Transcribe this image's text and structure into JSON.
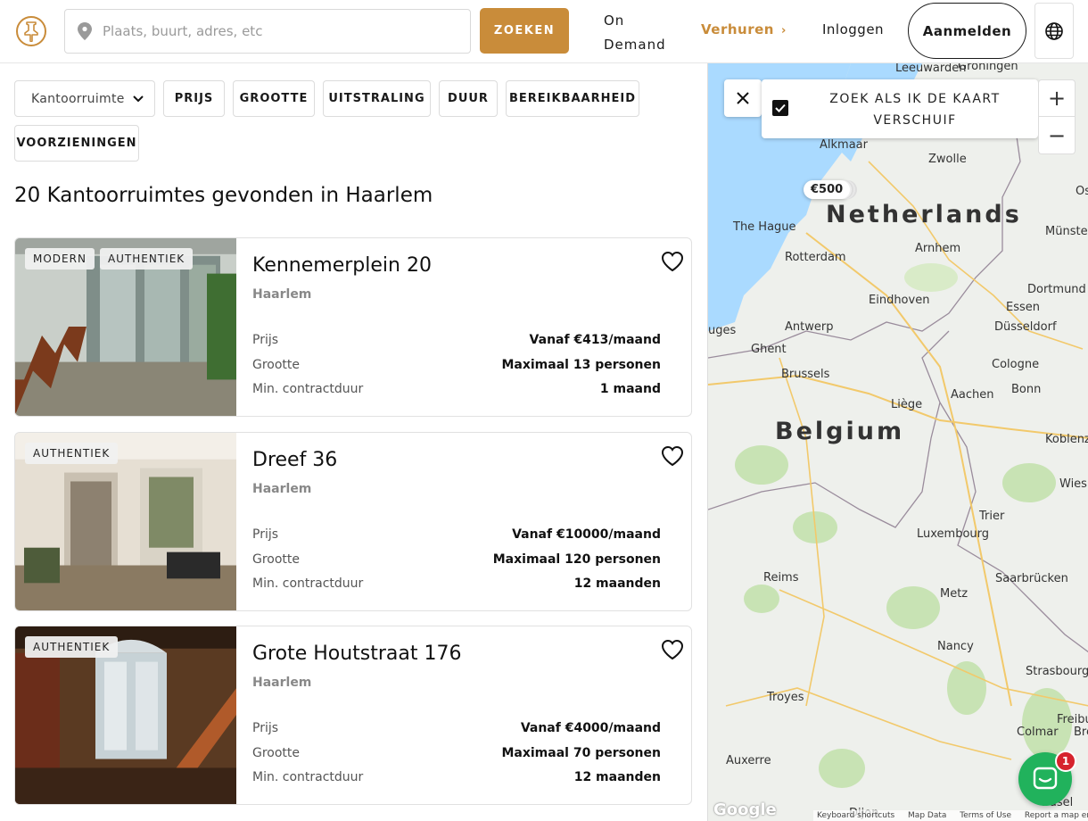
{
  "header": {
    "search_placeholder": "Plaats, buurt, adres, etc",
    "search_button": "ZOEKEN",
    "on_demand": "On Demand",
    "verhuren": "Verhuren",
    "inloggen": "Inloggen",
    "aanmelden": "Aanmelden"
  },
  "filters": {
    "type_select": "Kantoorruimte",
    "chips": [
      "PRIJS",
      "GROOTTE",
      "UITSTRALING",
      "DUUR",
      "BEREIKBAARHEID",
      "VOORZIENINGEN"
    ]
  },
  "results_title": "20 Kantoorruimtes gevonden in Haarlem",
  "listing_labels": {
    "price": "Prijs",
    "size": "Grootte",
    "min_duration": "Min. contractduur"
  },
  "listings": [
    {
      "title": "Kennemerplein 20",
      "city": "Haarlem",
      "badges": [
        "MODERN",
        "AUTHENTIEK"
      ],
      "price": "Vanaf €413/maand",
      "size": "Maximaal 13 personen",
      "min_duration": "1 maand"
    },
    {
      "title": "Dreef 36",
      "city": "Haarlem",
      "badges": [
        "AUTHENTIEK"
      ],
      "price": "Vanaf €10000/maand",
      "size": "Maximaal 120 personen",
      "min_duration": "12 maanden"
    },
    {
      "title": "Grote Houtstraat 176",
      "city": "Haarlem",
      "badges": [
        "AUTHENTIEK"
      ],
      "price": "Vanaf €4000/maand",
      "size": "Maximaal 70 personen",
      "min_duration": "12 maanden"
    }
  ],
  "map": {
    "search_on_move_label": "ZOEK ALS IK DE KAART VERSCHUIF",
    "search_on_move_checked": true,
    "zoom_in": "+",
    "zoom_out": "−",
    "price_pin": "€500",
    "countries": [
      "Netherlands",
      "Belgium"
    ],
    "cities": [
      "Leeuwarden",
      "Groningen",
      "Alkmaar",
      "Zwolle",
      "The Hague",
      "Rotterdam",
      "Arnhem",
      "Münster",
      "Eindhoven",
      "Dortmund",
      "Essen",
      "Antwerp",
      "Düsseldorf",
      "Ghent",
      "Brussels",
      "Cologne",
      "Aachen",
      "Bonn",
      "Liège",
      "Koblenz",
      "Wiesb",
      "Trier",
      "Luxembourg",
      "Saarbrücken",
      "Reims",
      "Metz",
      "Nancy",
      "Strasbourg",
      "Troyes",
      "Freibu",
      "Colmar",
      "Auxerre",
      "Basel",
      "Os",
      "uges",
      "Breis",
      "Dijon"
    ],
    "footer": [
      "Keyboard shortcuts",
      "Map Data",
      "Terms of Use",
      "Report a map error"
    ],
    "google": "Google"
  },
  "chat": {
    "unread_count": "1"
  },
  "colors": {
    "accent": "#c98c3a",
    "chat": "#21b25c",
    "badge": "#d6232d"
  }
}
